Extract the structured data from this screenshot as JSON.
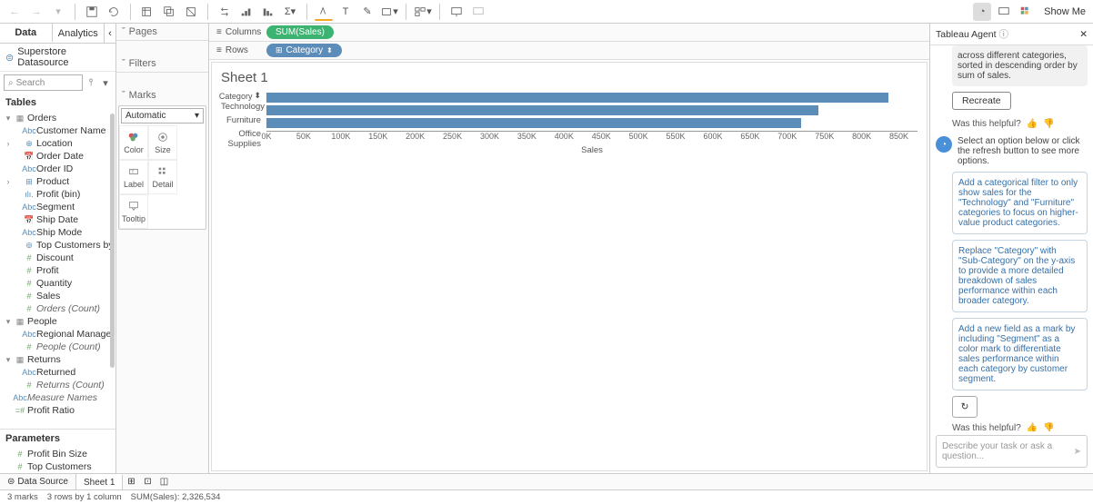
{
  "toolbar": {
    "showme": "Show Me"
  },
  "left": {
    "tabs": {
      "data": "Data",
      "analytics": "Analytics"
    },
    "datasource": "Superstore Datasource",
    "search_ph": "Search",
    "tables_h": "Tables",
    "params_h": "Parameters",
    "tree": [
      {
        "g": "Orders",
        "items": [
          {
            "ic": "Abc",
            "l": "Customer Name"
          },
          {
            "ic": "⊕",
            "l": "Location",
            "chev": "›"
          },
          {
            "ic": "📅",
            "l": "Order Date"
          },
          {
            "ic": "Abc",
            "l": "Order ID"
          },
          {
            "ic": "⊞",
            "l": "Product",
            "chev": "›"
          },
          {
            "ic": "ılı.",
            "l": "Profit (bin)"
          },
          {
            "ic": "Abc",
            "l": "Segment"
          },
          {
            "ic": "📅",
            "l": "Ship Date"
          },
          {
            "ic": "Abc",
            "l": "Ship Mode"
          },
          {
            "ic": "⊚",
            "l": "Top Customers by P..."
          },
          {
            "ic": "#",
            "l": "Discount"
          },
          {
            "ic": "#",
            "l": "Profit"
          },
          {
            "ic": "#",
            "l": "Quantity"
          },
          {
            "ic": "#",
            "l": "Sales"
          },
          {
            "ic": "#",
            "l": "Orders (Count)",
            "it": true
          }
        ]
      },
      {
        "g": "People",
        "items": [
          {
            "ic": "Abc",
            "l": "Regional Manager"
          },
          {
            "ic": "#",
            "l": "People (Count)",
            "it": true
          }
        ]
      },
      {
        "g": "Returns",
        "items": [
          {
            "ic": "Abc",
            "l": "Returned"
          },
          {
            "ic": "#",
            "l": "Returns (Count)",
            "it": true
          }
        ]
      }
    ],
    "loose": [
      {
        "ic": "Abc",
        "l": "Measure Names",
        "it": true
      },
      {
        "ic": "=#",
        "l": "Profit Ratio"
      }
    ],
    "params": [
      {
        "ic": "#",
        "l": "Profit Bin Size"
      },
      {
        "ic": "#",
        "l": "Top Customers"
      }
    ]
  },
  "col2": {
    "pages": "Pages",
    "filters": "Filters",
    "marks": "Marks",
    "automatic": "Automatic",
    "btns": {
      "color": "Color",
      "size": "Size",
      "label": "Label",
      "detail": "Detail",
      "tooltip": "Tooltip"
    }
  },
  "shelves": {
    "columns": "Columns",
    "rows": "Rows",
    "colpill": "SUM(Sales)",
    "rowpill": "Category"
  },
  "sheet": {
    "title": "Sheet 1",
    "catheader": "Category",
    "axislabel": "Sales"
  },
  "chart_data": {
    "type": "bar",
    "categories": [
      "Technology",
      "Furniture",
      "Office Supplies"
    ],
    "values": [
      836000,
      742000,
      719000
    ],
    "xlabel": "Sales",
    "ylabel": "Category",
    "xlim": [
      0,
      875000
    ],
    "ticks": [
      "0K",
      "50K",
      "100K",
      "150K",
      "200K",
      "250K",
      "300K",
      "350K",
      "400K",
      "450K",
      "500K",
      "550K",
      "600K",
      "650K",
      "700K",
      "750K",
      "800K",
      "850K"
    ]
  },
  "agent": {
    "title": "Tableau Agent",
    "msg1": "across different categories, sorted in descending order by sum of sales.",
    "recreate": "Recreate",
    "helpful": "Was this helpful?",
    "select": "Select an option below or click the refresh button to see more options.",
    "opts": [
      "Add a categorical filter to only show sales for the \"Technology\" and \"Furniture\" categories to focus on higher-value product categories.",
      "Replace \"Category\" with \"Sub-Category\" on the y-axis to provide a more detailed breakdown of sales performance within each broader category.",
      "Add a new field as a mark by including \"Segment\" as a color mark to differentiate sales performance within each category by customer segment."
    ],
    "input_ph": "Describe your task or ask a question..."
  },
  "bottom": {
    "datasource": "Data Source",
    "sheet": "Sheet 1"
  },
  "status": {
    "marks": "3 marks",
    "rows": "3 rows by 1 column",
    "sum": "SUM(Sales): 2,326,534"
  }
}
